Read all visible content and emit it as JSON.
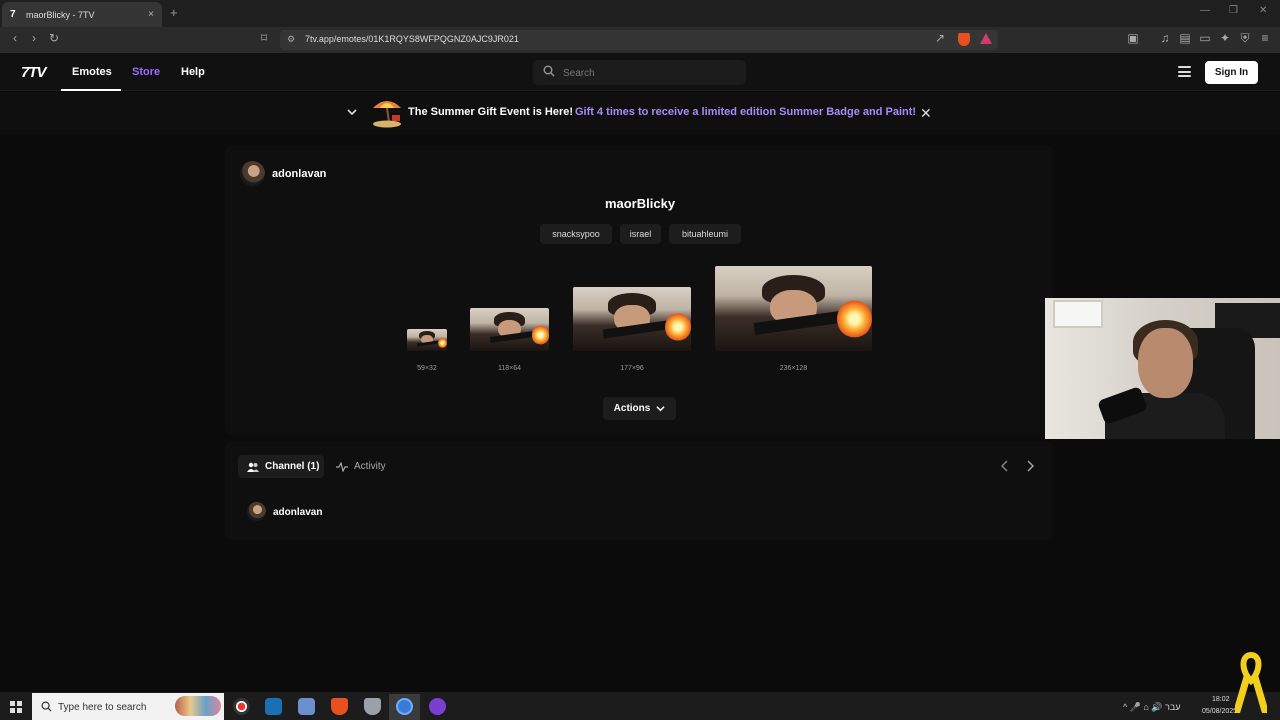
{
  "browser": {
    "tab_title": "maorBlicky - 7TV",
    "tab_close": "×",
    "new_tab": "+",
    "url": "7tv.app/emotes/01K1RQYS8WFPQGNZ0AJC9JR021"
  },
  "site": {
    "logo": "7TV",
    "nav": [
      "Emotes",
      "Store",
      "Help"
    ],
    "search_placeholder": "Search",
    "sign_in": "Sign In"
  },
  "banner": {
    "title": "The Summer Gift Event is Here!",
    "link": "Gift 4 times to receive a limited edition Summer Badge and Paint!",
    "close": "✕"
  },
  "emote": {
    "owner": "adonlavan",
    "name": "maorBlicky",
    "tags": [
      "snacksypoo",
      "israel",
      "bituahleumi"
    ],
    "sizes": [
      "59×32",
      "118×64",
      "177×96",
      "236×128"
    ],
    "actions_label": "Actions"
  },
  "channels": {
    "tab_channel": "Channel (1)",
    "tab_activity": "Activity",
    "entries": [
      {
        "name": "adonlavan"
      }
    ]
  },
  "taskbar": {
    "search_placeholder": "Type here to search",
    "tray": "^ 🎤 ⌂ 🔊 עבר",
    "time": "18:02",
    "date": "05/08/2025"
  },
  "colors": {
    "accent": "#9b6cff",
    "banner_link": "#a78bfa"
  }
}
